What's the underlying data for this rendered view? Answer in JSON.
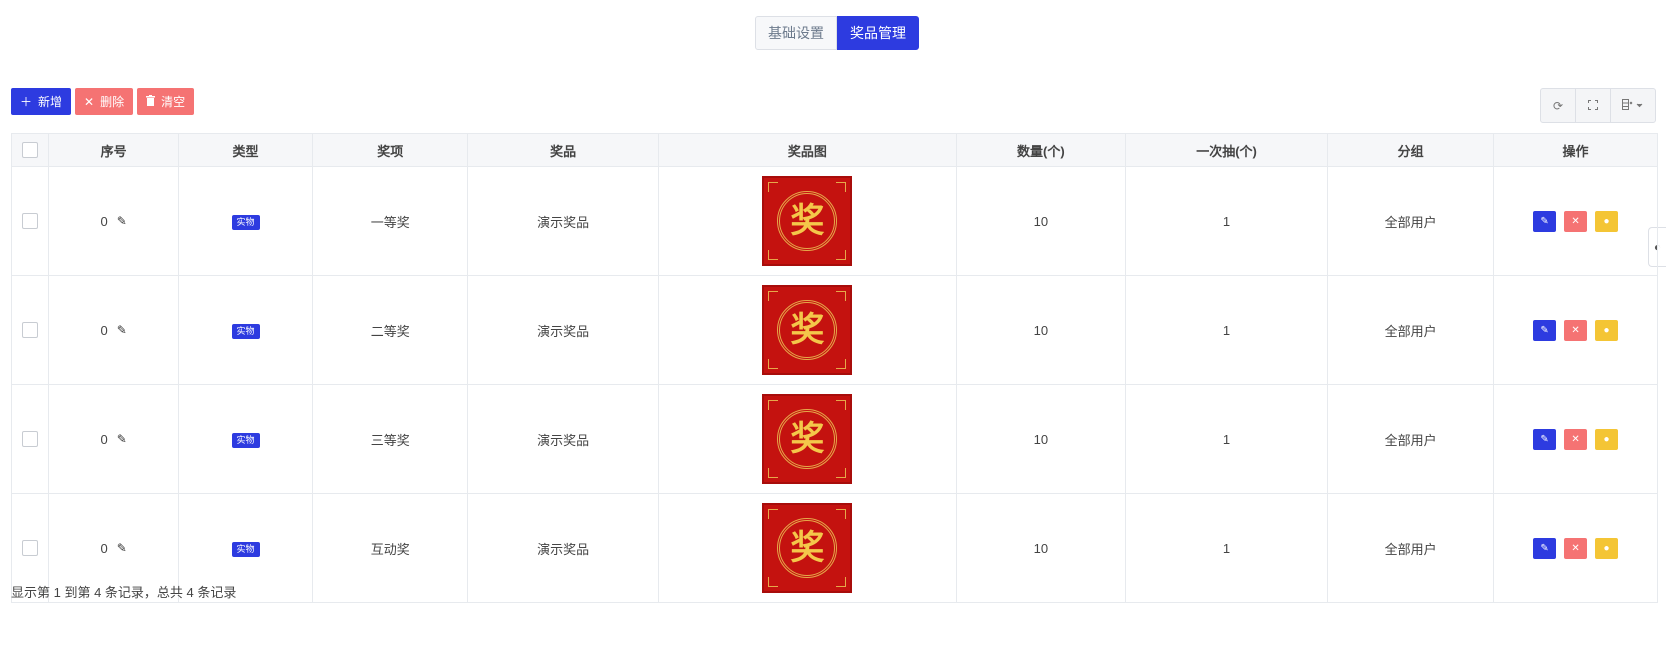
{
  "tabs": [
    {
      "label": "基础设置",
      "active": false
    },
    {
      "label": "奖品管理",
      "active": true
    }
  ],
  "toolbar": {
    "add_label": "新增",
    "delete_label": "删除",
    "clear_label": "清空"
  },
  "table": {
    "headers": [
      "序号",
      "类型",
      "奖项",
      "奖品",
      "奖品图",
      "数量(个)",
      "一次抽(个)",
      "分组",
      "操作"
    ],
    "rows": [
      {
        "seq": "0",
        "type": "实物",
        "award": "一等奖",
        "prize": "演示奖品",
        "image_char": "奖",
        "quantity": "10",
        "per_draw": "1",
        "group": "全部用户"
      },
      {
        "seq": "0",
        "type": "实物",
        "award": "二等奖",
        "prize": "演示奖品",
        "image_char": "奖",
        "quantity": "10",
        "per_draw": "1",
        "group": "全部用户"
      },
      {
        "seq": "0",
        "type": "实物",
        "award": "三等奖",
        "prize": "演示奖品",
        "image_char": "奖",
        "quantity": "10",
        "per_draw": "1",
        "group": "全部用户"
      },
      {
        "seq": "0",
        "type": "实物",
        "award": "互动奖",
        "prize": "演示奖品",
        "image_char": "奖",
        "quantity": "10",
        "per_draw": "1",
        "group": "全部用户"
      }
    ]
  },
  "pagination": {
    "summary": "显示第 1 到第 4 条记录，总共 4 条记录"
  },
  "colors": {
    "primary": "#2d3be0",
    "danger": "#f57373",
    "warning": "#f4c535",
    "prize_red": "#c4120f",
    "prize_gold": "#f4c74a"
  },
  "icons": {
    "add": "plus-icon",
    "delete": "x-icon",
    "clear": "trash-icon",
    "refresh": "refresh-icon",
    "fullscreen": "fullscreen-icon",
    "columns": "columns-icon",
    "edit": "pencil-icon",
    "user": "user-icon"
  }
}
